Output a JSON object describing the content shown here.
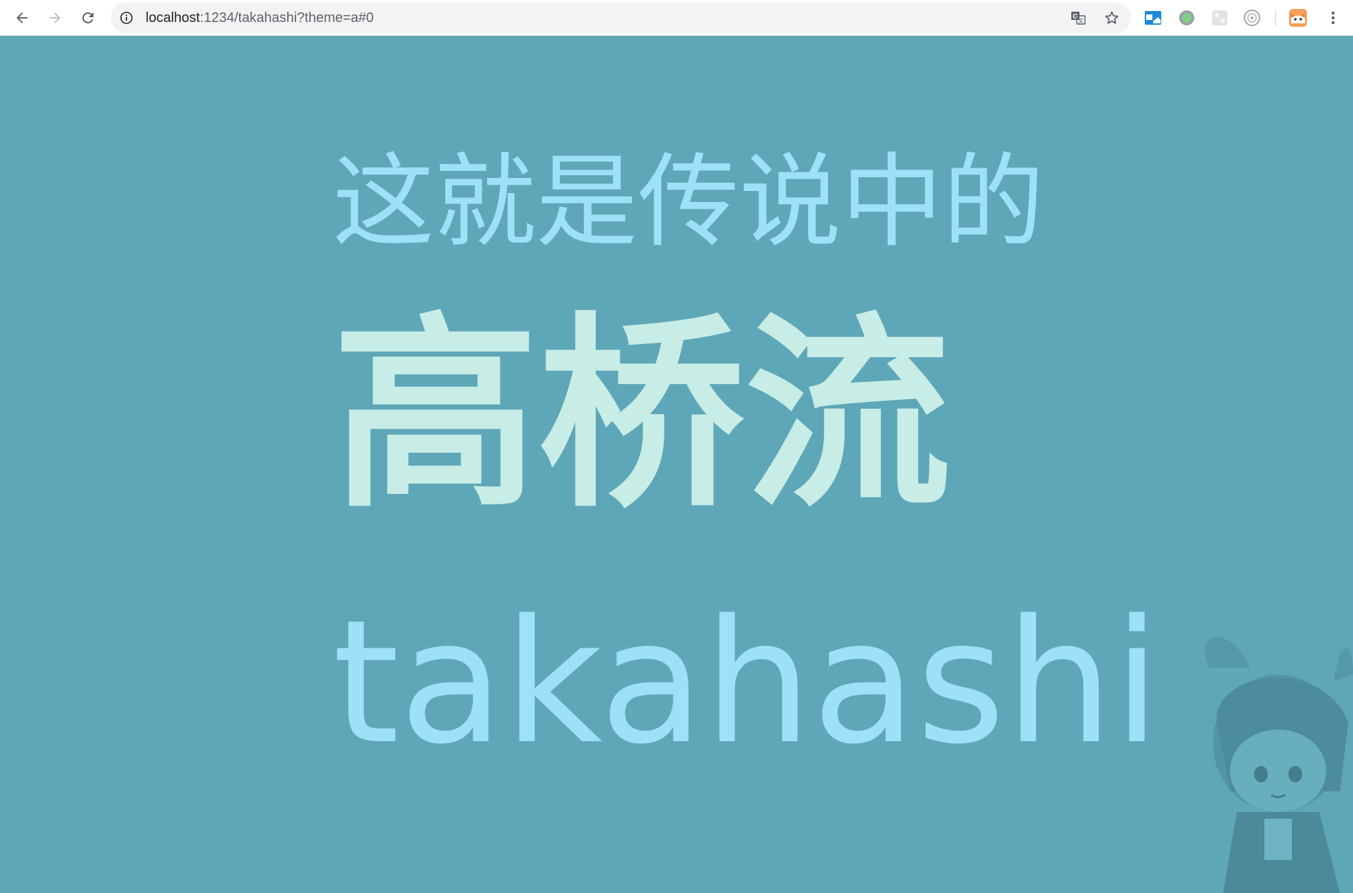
{
  "browser": {
    "url_host": "localhost",
    "url_path": ":1234/takahashi?theme=a#0"
  },
  "slide": {
    "line1": "这就是传说中的",
    "line2": "高桥流",
    "line3": "takahashi"
  },
  "colors": {
    "background": "#5ea7b8",
    "text_light_blue": "#9ee0f8",
    "text_mint": "#c8ece6"
  },
  "icons": {
    "back": "back-arrow-icon",
    "forward": "forward-arrow-icon",
    "reload": "reload-icon",
    "info": "info-icon",
    "translate": "translate-icon",
    "bookmark": "star-icon",
    "menu": "kebab-menu-icon"
  }
}
